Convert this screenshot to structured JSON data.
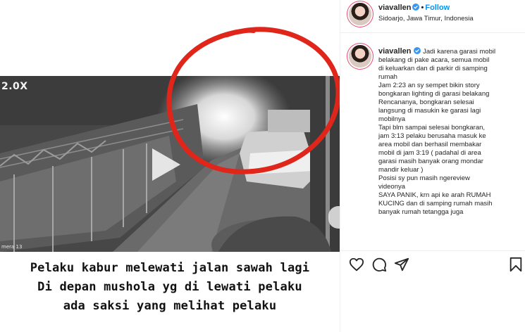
{
  "post": {
    "speed_label": "2.0X",
    "camera_label": "mera 13",
    "caption_lines": [
      "Pelaku kabur melewati jalan sawah lagi",
      "Di depan mushola yg di lewati pelaku",
      "ada saksi yang melihat pelaku"
    ]
  },
  "header": {
    "username": "viavallen",
    "separator": "•",
    "follow_label": "Follow",
    "location": "Sidoarjo, Jawa Timur, Indonesia"
  },
  "comment": {
    "username": "viavallen",
    "lines": [
      "Jadi karena garasi mobil",
      "belakang di pake acara, semua mobil",
      "di keluarkan dan di parkir di samping",
      "rumah",
      "Jam 2:23 an sy sempet bikin story",
      "bongkaran lighting di garasi belakang",
      "Rencananya, bongkaran selesai",
      "langsung di masukin ke garasi lagi",
      "mobilnya",
      "Tapi blm sampai selesai bongkaran,",
      "jam 3:13 pelaku berusaha masuk ke",
      "area mobil dan berhasil membakar",
      "mobil di jam 3:19 ( padahal di area",
      "garasi masih banyak orang mondar",
      "mandir keluar )",
      "Posisi sy pun masih ngereview",
      "videonya",
      "SAYA PANIK, krn api ke arah RUMAH",
      "KUCING dan di samping rumah masih",
      "banyak rumah tetangga juga"
    ]
  },
  "icons": {
    "like": "heart-icon",
    "comment": "comment-icon",
    "share": "send-icon",
    "save": "bookmark-icon",
    "verified": "verified-badge-icon",
    "play": "play-icon"
  },
  "colors": {
    "accent": "#0095f6",
    "ring": "#e0251b",
    "text": "#262626",
    "border": "#efefef"
  }
}
